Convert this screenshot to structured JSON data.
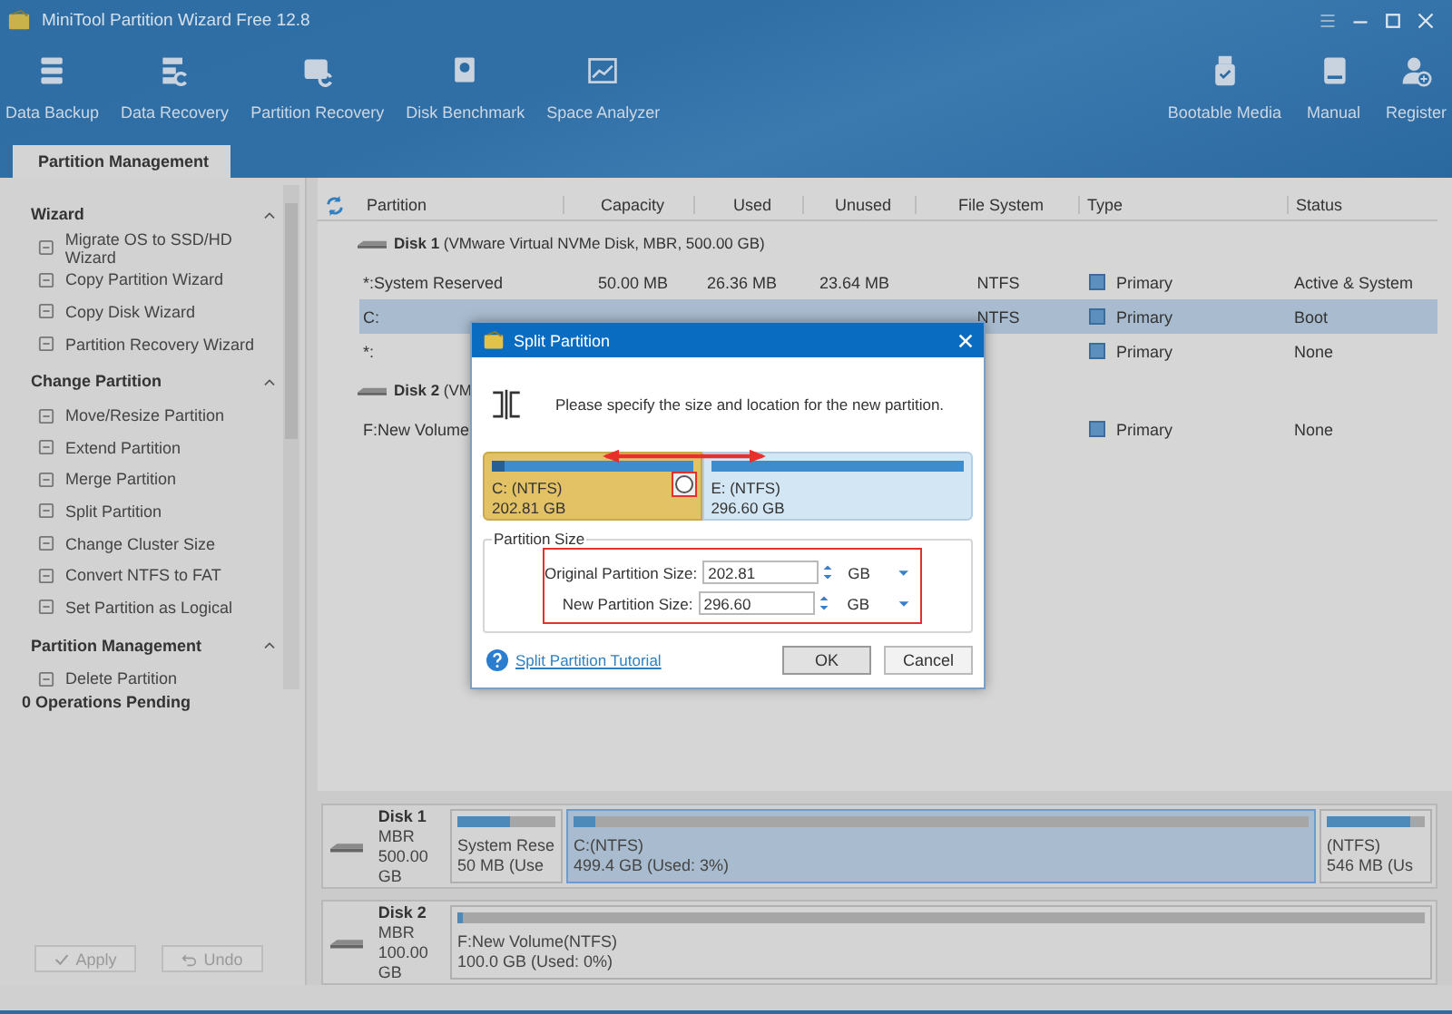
{
  "window": {
    "title": "MiniTool Partition Wizard Free 12.8"
  },
  "toolbar": {
    "left": [
      {
        "label": "Data Backup"
      },
      {
        "label": "Data Recovery"
      },
      {
        "label": "Partition Recovery"
      },
      {
        "label": "Disk Benchmark"
      },
      {
        "label": "Space Analyzer"
      }
    ],
    "right": [
      {
        "label": "Bootable Media"
      },
      {
        "label": "Manual"
      },
      {
        "label": "Register"
      }
    ]
  },
  "tabs": [
    {
      "label": "Partition Management",
      "selected": true
    }
  ],
  "sidebar": {
    "sections": [
      {
        "title": "Wizard",
        "expanded": true,
        "items": [
          "Migrate OS to SSD/HD Wizard",
          "Copy Partition Wizard",
          "Copy Disk Wizard",
          "Partition Recovery Wizard"
        ]
      },
      {
        "title": "Change Partition",
        "expanded": true,
        "items": [
          "Move/Resize Partition",
          "Extend Partition",
          "Merge Partition",
          "Split Partition",
          "Change Cluster Size",
          "Convert NTFS to FAT",
          "Set Partition as Logical"
        ]
      },
      {
        "title": "Partition Management",
        "expanded": true,
        "items": [
          "Delete Partition"
        ]
      }
    ],
    "pending": "0 Operations Pending",
    "buttons": [
      {
        "label": "Apply",
        "kind": "apply",
        "disabled": true
      },
      {
        "label": "Undo",
        "kind": "undo",
        "disabled": true
      }
    ]
  },
  "table": {
    "columns": [
      "Partition",
      "Capacity",
      "Used",
      "Unused",
      "File System",
      "Type",
      "Status"
    ],
    "rows": [
      {
        "kind": "disk",
        "label": "**Disk 1** (VMware Virtual NVMe Disk, MBR, 500.00 GB)"
      },
      {
        "kind": "partition",
        "selected": false,
        "cells": [
          "*:System Reserved",
          "50.00 MB",
          "26.36 MB",
          "23.64 MB",
          "NTFS",
          "Primary",
          "Active & System"
        ]
      },
      {
        "kind": "partition",
        "selected": true,
        "cells": [
          "C:",
          "",
          "",
          "",
          "NTFS",
          "Primary",
          "Boot"
        ]
      },
      {
        "kind": "partition",
        "selected": false,
        "cells": [
          "*:",
          "",
          "",
          "",
          "",
          "Primary",
          "None"
        ]
      },
      {
        "kind": "disk",
        "label": "**Disk 2** (VM"
      },
      {
        "kind": "partition",
        "selected": false,
        "cells": [
          "F:New Volume",
          "",
          "",
          "",
          "",
          "Primary",
          "None"
        ]
      }
    ]
  },
  "disk_map": [
    {
      "name": "Disk 1",
      "scheme": "MBR",
      "size": "500.00 GB",
      "partitions": [
        {
          "label": "System Rese",
          "detail": "50 MB (Use",
          "level": 0.53,
          "selected": false
        },
        {
          "label": "C:(NTFS)",
          "detail": "499.4 GB (Used: 3%)",
          "level": 0.03,
          "selected": true
        },
        {
          "label": "(NTFS)",
          "detail": "546 MB (Us",
          "level": 0.85,
          "selected": false
        }
      ]
    },
    {
      "name": "Disk 2",
      "scheme": "MBR",
      "size": "100.00 GB",
      "partitions": [
        {
          "label": "F:New Volume(NTFS)",
          "detail": "100.0 GB (Used: 0%)",
          "level": 0.005,
          "selected": false
        }
      ]
    }
  ],
  "dialog": {
    "title": "Split Partition",
    "message": "Please specify the size and location for the new partition.",
    "split": {
      "parts": [
        {
          "label": "C: (NTFS)",
          "size": "202.81 GB"
        },
        {
          "label": "E: (NTFS)",
          "size": "296.60 GB"
        }
      ]
    },
    "group_title": "Partition Size",
    "fields": [
      {
        "label": "Original Partition Size:",
        "value": "202.81",
        "unit": "GB"
      },
      {
        "label": "New Partition Size:",
        "value": "296.60",
        "unit": "GB"
      }
    ],
    "link": "Split Partition Tutorial",
    "buttons": [
      "OK",
      "Cancel"
    ]
  }
}
